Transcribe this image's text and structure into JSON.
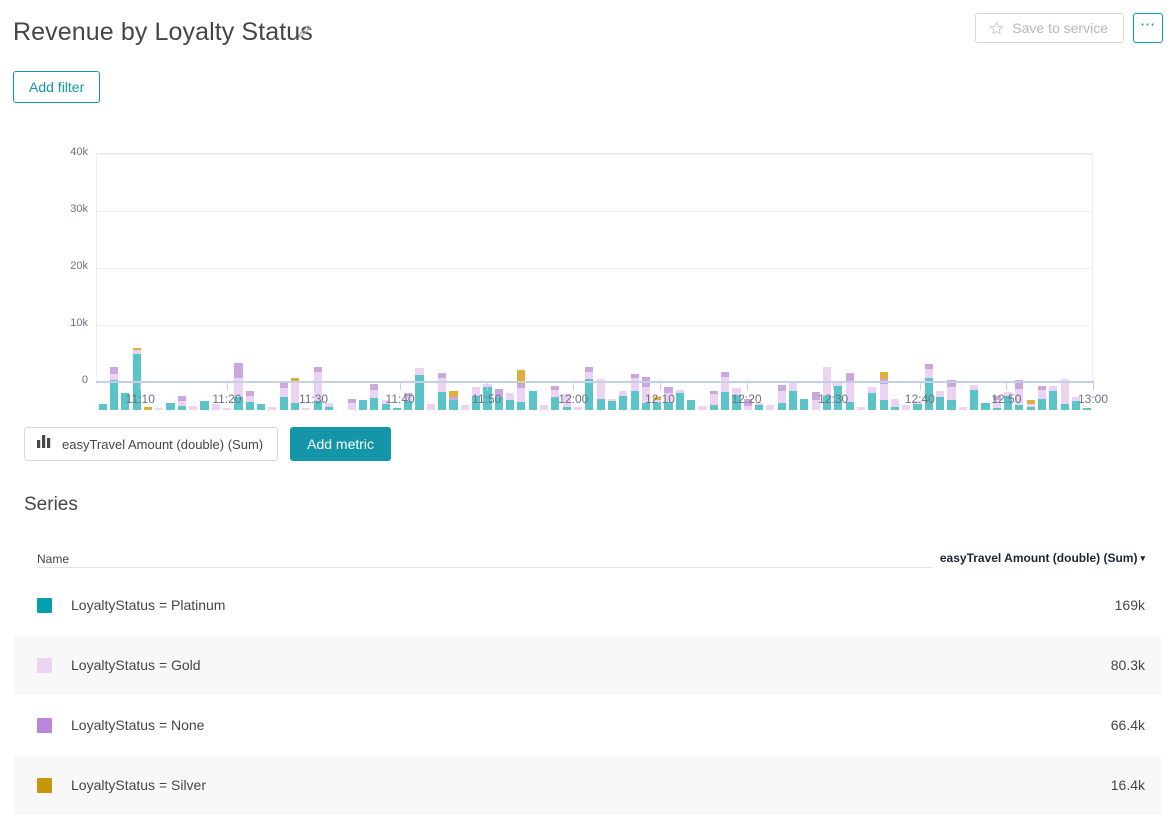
{
  "header": {
    "title": "Revenue by Loyalty Status",
    "edit_icon": "pencil-icon",
    "save_button": {
      "label": "Save to service",
      "icon": "star-icon",
      "disabled": true
    },
    "more_button": {
      "label": "⋯",
      "icon": "more-options-icon"
    }
  },
  "filters": {
    "add_filter_label": "Add filter"
  },
  "metric_row": {
    "chip_label": "easyTravel Amount (double) (Sum)",
    "chip_icon": "bar-chart-icon",
    "add_metric_label": "Add metric"
  },
  "series_section": {
    "title": "Series",
    "columns": {
      "name": "Name",
      "metric": "easyTravel Amount (double) (Sum)",
      "sort_caret": "▾"
    },
    "rows": [
      {
        "name": "LoyaltyStatus = Platinum",
        "value": "169k",
        "color": "#00a0b0"
      },
      {
        "name": "LoyaltyStatus = Gold",
        "value": "80.3k",
        "color": "#ecd3f2"
      },
      {
        "name": "LoyaltyStatus = None",
        "value": "66.4k",
        "color": "#bb86d9"
      },
      {
        "name": "LoyaltyStatus = Silver",
        "value": "16.4k",
        "color": "#c8960c"
      }
    ]
  },
  "colors": {
    "accent": "#1496a8",
    "platinum": "#5bc4c8",
    "gold": "#ecd3f2",
    "none": "#c9a8e0",
    "silver": "#dfae3f",
    "grid": "#eceff1",
    "axis": "#c5cfe3"
  },
  "chart_data": {
    "type": "bar",
    "stacked": true,
    "title": "Revenue by Loyalty Status",
    "xlabel": "",
    "ylabel": "",
    "ylim": [
      0,
      40000
    ],
    "yticks": [
      "0",
      "10k",
      "20k",
      "30k",
      "40k"
    ],
    "ytick_values": [
      0,
      10000,
      20000,
      30000,
      40000
    ],
    "grid": true,
    "legend_position": "below-table",
    "xtick_labels": [
      "11:10",
      "11:20",
      "11:30",
      "11:40",
      "11:50",
      "12:00",
      "12:10",
      "12:20",
      "12:30",
      "12:40",
      "12:50",
      "13:00"
    ],
    "x_start": "11:05",
    "x_end": "13:00",
    "series": [
      {
        "name": "LoyaltyStatus = Platinum",
        "color": "#5bc4c8",
        "values": [
          1100,
          5200,
          2900,
          9900,
          0,
          0,
          1200,
          700,
          0,
          1500,
          0,
          0,
          2300,
          1400,
          1000,
          0,
          2200,
          1200,
          0,
          1500,
          600,
          0,
          0,
          1700,
          2100,
          1100,
          200,
          1500,
          6100,
          0,
          3100,
          1700,
          0,
          2400,
          4000,
          2300,
          1800,
          1400,
          3300,
          0,
          2200,
          500,
          0,
          5500,
          1900,
          1500,
          2500,
          3400,
          1200,
          1200,
          1400,
          2900,
          1700,
          0,
          900,
          3200,
          2600,
          0,
          800,
          0,
          1200,
          3400,
          2000,
          0,
          2400,
          4300,
          1400,
          0,
          2900,
          1800,
          600,
          0,
          1100,
          5600,
          2200,
          1700,
          0,
          3500,
          1200,
          400,
          2500,
          900,
          600,
          2000,
          3300,
          1100,
          1600,
          400
        ]
      },
      {
        "name": "LoyaltyStatus = Gold",
        "color": "#ecd3f2",
        "values": [
          0,
          1200,
          0,
          600,
          0,
          400,
          0,
          900,
          700,
          0,
          1100,
          300,
          3300,
          1000,
          0,
          600,
          1600,
          3800,
          300,
          5200,
          600,
          0,
          1200,
          0,
          1400,
          700,
          0,
          900,
          1300,
          1100,
          2500,
          0,
          800,
          1600,
          600,
          0,
          1200,
          2400,
          0,
          900,
          1400,
          2300,
          600,
          1100,
          3600,
          400,
          900,
          2300,
          2800,
          500,
          1500,
          600,
          0,
          700,
          1900,
          2600,
          1200,
          700,
          400,
          800,
          2100,
          1500,
          0,
          1700,
          5100,
          400,
          3500,
          600,
          1100,
          2700,
          1300,
          800,
          400,
          1600,
          1200,
          2300,
          600,
          900,
          0,
          1300,
          600,
          2800,
          400,
          1600,
          900,
          4300,
          700,
          0,
          0
        ]
      },
      {
        "name": "LoyaltyStatus = None",
        "color": "#c9a8e0",
        "values": [
          0,
          1100,
          0,
          0,
          0,
          0,
          0,
          800,
          0,
          0,
          0,
          0,
          2600,
          900,
          0,
          0,
          1100,
          0,
          0,
          800,
          0,
          0,
          700,
          0,
          1000,
          0,
          0,
          600,
          0,
          0,
          900,
          600,
          0,
          0,
          0,
          1300,
          0,
          800,
          0,
          0,
          700,
          0,
          0,
          900,
          0,
          0,
          0,
          700,
          1800,
          0,
          1100,
          0,
          0,
          0,
          600,
          800,
          0,
          1200,
          0,
          0,
          1100,
          0,
          0,
          1400,
          0,
          0,
          1600,
          0,
          0,
          900,
          0,
          0,
          0,
          800,
          0,
          1200,
          0,
          0,
          0,
          700,
          0,
          1600,
          0,
          700,
          0,
          0,
          0,
          0,
          0
        ]
      },
      {
        "name": "LoyaltyStatus = Silver",
        "color": "#dfae3f",
        "values": [
          0,
          0,
          0,
          400,
          500,
          0,
          0,
          0,
          0,
          0,
          0,
          0,
          0,
          0,
          0,
          0,
          0,
          700,
          0,
          0,
          0,
          0,
          0,
          0,
          0,
          0,
          0,
          0,
          0,
          0,
          0,
          1100,
          0,
          0,
          0,
          0,
          0,
          2400,
          0,
          0,
          0,
          0,
          0,
          0,
          0,
          0,
          0,
          0,
          0,
          600,
          0,
          0,
          0,
          0,
          0,
          0,
          0,
          0,
          0,
          0,
          0,
          0,
          0,
          0,
          0,
          0,
          0,
          0,
          0,
          1300,
          0,
          0,
          0,
          0,
          0,
          0,
          0,
          0,
          0,
          0,
          0,
          0,
          700,
          0,
          0,
          0,
          0,
          0,
          0
        ]
      }
    ]
  }
}
